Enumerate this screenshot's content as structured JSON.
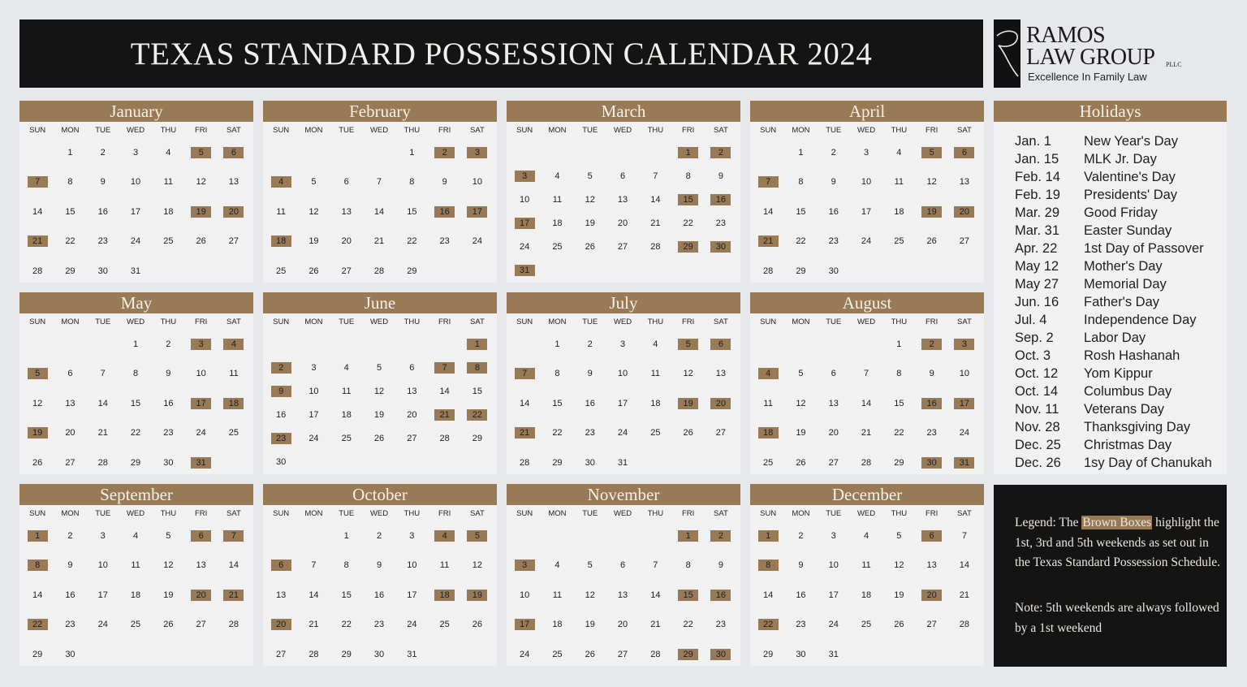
{
  "title": "TEXAS STANDARD POSSESSION CALENDAR 2024",
  "logo": {
    "line1": "RAMOS",
    "line2": "LAW GROUP",
    "suffix": "PLLC",
    "tagline": "Excellence In Family Law"
  },
  "colors": {
    "accent_brown": "#987a57",
    "title_bar": "#141414",
    "panel": "#f1f1f2",
    "background": "#e6e8eb"
  },
  "weekday_labels": [
    "SUN",
    "MON",
    "TUE",
    "WED",
    "THU",
    "FRI",
    "SAT"
  ],
  "months": [
    {
      "name": "January",
      "weeks": [
        [
          "",
          "1",
          "2",
          "3",
          "4",
          "5",
          "6"
        ],
        [
          "7",
          "8",
          "9",
          "10",
          "11",
          "12",
          "13"
        ],
        [
          "14",
          "15",
          "16",
          "17",
          "18",
          "19",
          "20"
        ],
        [
          "21",
          "22",
          "23",
          "24",
          "25",
          "26",
          "27"
        ],
        [
          "28",
          "29",
          "30",
          "31",
          "",
          "",
          ""
        ]
      ],
      "highlighted": [
        "5",
        "6",
        "7",
        "19",
        "20",
        "21"
      ]
    },
    {
      "name": "February",
      "weeks": [
        [
          "",
          "",
          "",
          "",
          "1",
          "2",
          "3"
        ],
        [
          "4",
          "5",
          "6",
          "7",
          "8",
          "9",
          "10"
        ],
        [
          "11",
          "12",
          "13",
          "14",
          "15",
          "16",
          "17"
        ],
        [
          "18",
          "19",
          "20",
          "21",
          "22",
          "23",
          "24"
        ],
        [
          "25",
          "26",
          "27",
          "28",
          "29",
          "",
          ""
        ]
      ],
      "highlighted": [
        "2",
        "3",
        "4",
        "16",
        "17",
        "18"
      ]
    },
    {
      "name": "March",
      "weeks": [
        [
          "",
          "",
          "",
          "",
          "",
          "1",
          "2"
        ],
        [
          "3",
          "4",
          "5",
          "6",
          "7",
          "8",
          "9"
        ],
        [
          "10",
          "11",
          "12",
          "13",
          "14",
          "15",
          "16"
        ],
        [
          "17",
          "18",
          "19",
          "20",
          "21",
          "22",
          "23"
        ],
        [
          "24",
          "25",
          "26",
          "27",
          "28",
          "29",
          "30"
        ],
        [
          "31",
          "",
          "",
          "",
          "",
          "",
          ""
        ]
      ],
      "highlighted": [
        "1",
        "2",
        "3",
        "15",
        "16",
        "17",
        "29",
        "30",
        "31"
      ]
    },
    {
      "name": "April",
      "weeks": [
        [
          "",
          "1",
          "2",
          "3",
          "4",
          "5",
          "6"
        ],
        [
          "7",
          "8",
          "9",
          "10",
          "11",
          "12",
          "13"
        ],
        [
          "14",
          "15",
          "16",
          "17",
          "18",
          "19",
          "20"
        ],
        [
          "21",
          "22",
          "23",
          "24",
          "25",
          "26",
          "27"
        ],
        [
          "28",
          "29",
          "30",
          "",
          "",
          "",
          ""
        ]
      ],
      "highlighted": [
        "5",
        "6",
        "7",
        "19",
        "20",
        "21"
      ]
    },
    {
      "name": "May",
      "weeks": [
        [
          "",
          "",
          "",
          "1",
          "2",
          "3",
          "4"
        ],
        [
          "5",
          "6",
          "7",
          "8",
          "9",
          "10",
          "11"
        ],
        [
          "12",
          "13",
          "14",
          "15",
          "16",
          "17",
          "18"
        ],
        [
          "19",
          "20",
          "21",
          "22",
          "23",
          "24",
          "25"
        ],
        [
          "26",
          "27",
          "28",
          "29",
          "30",
          "31",
          ""
        ]
      ],
      "highlighted": [
        "3",
        "4",
        "5",
        "17",
        "18",
        "19",
        "31"
      ]
    },
    {
      "name": "June",
      "weeks": [
        [
          "",
          "",
          "",
          "",
          "",
          "",
          "1"
        ],
        [
          "2",
          "3",
          "4",
          "5",
          "6",
          "7",
          "8"
        ],
        [
          "9",
          "10",
          "11",
          "12",
          "13",
          "14",
          "15"
        ],
        [
          "16",
          "17",
          "18",
          "19",
          "20",
          "21",
          "22"
        ],
        [
          "23",
          "24",
          "25",
          "26",
          "27",
          "28",
          "29"
        ],
        [
          "30",
          "",
          "",
          "",
          "",
          "",
          ""
        ]
      ],
      "highlighted": [
        "1",
        "2",
        "7",
        "8",
        "9",
        "21",
        "22",
        "23"
      ]
    },
    {
      "name": "July",
      "weeks": [
        [
          "",
          "1",
          "2",
          "3",
          "4",
          "5",
          "6"
        ],
        [
          "7",
          "8",
          "9",
          "10",
          "11",
          "12",
          "13"
        ],
        [
          "14",
          "15",
          "16",
          "17",
          "18",
          "19",
          "20"
        ],
        [
          "21",
          "22",
          "23",
          "24",
          "25",
          "26",
          "27"
        ],
        [
          "28",
          "29",
          "30",
          "31",
          "",
          "",
          ""
        ]
      ],
      "highlighted": [
        "5",
        "6",
        "7",
        "19",
        "20",
        "21"
      ]
    },
    {
      "name": "August",
      "weeks": [
        [
          "",
          "",
          "",
          "",
          "1",
          "2",
          "3"
        ],
        [
          "4",
          "5",
          "6",
          "7",
          "8",
          "9",
          "10"
        ],
        [
          "11",
          "12",
          "13",
          "14",
          "15",
          "16",
          "17"
        ],
        [
          "18",
          "19",
          "20",
          "21",
          "22",
          "23",
          "24"
        ],
        [
          "25",
          "26",
          "27",
          "28",
          "29",
          "30",
          "31"
        ]
      ],
      "highlighted": [
        "2",
        "3",
        "4",
        "16",
        "17",
        "18",
        "30",
        "31"
      ]
    },
    {
      "name": "September",
      "weeks": [
        [
          "1",
          "2",
          "3",
          "4",
          "5",
          "6",
          "7"
        ],
        [
          "8",
          "9",
          "10",
          "11",
          "12",
          "13",
          "14"
        ],
        [
          "14",
          "16",
          "17",
          "18",
          "19",
          "20",
          "21"
        ],
        [
          "22",
          "23",
          "24",
          "25",
          "26",
          "27",
          "28"
        ],
        [
          "29",
          "30",
          "",
          "",
          "",
          "",
          ""
        ]
      ],
      "highlighted": [
        "1",
        "6",
        "7",
        "8",
        "20",
        "21",
        "22"
      ]
    },
    {
      "name": "October",
      "weeks": [
        [
          "",
          "",
          "1",
          "2",
          "3",
          "4",
          "5"
        ],
        [
          "6",
          "7",
          "8",
          "9",
          "10",
          "11",
          "12"
        ],
        [
          "13",
          "14",
          "15",
          "16",
          "17",
          "18",
          "19"
        ],
        [
          "20",
          "21",
          "22",
          "23",
          "24",
          "25",
          "26"
        ],
        [
          "27",
          "28",
          "29",
          "30",
          "31",
          "",
          ""
        ]
      ],
      "highlighted": [
        "4",
        "5",
        "6",
        "18",
        "19",
        "20"
      ]
    },
    {
      "name": "November",
      "weeks": [
        [
          "",
          "",
          "",
          "",
          "",
          "1",
          "2"
        ],
        [
          "3",
          "4",
          "5",
          "6",
          "7",
          "8",
          "9"
        ],
        [
          "10",
          "11",
          "12",
          "13",
          "14",
          "15",
          "16"
        ],
        [
          "17",
          "18",
          "19",
          "20",
          "21",
          "22",
          "23"
        ],
        [
          "24",
          "25",
          "26",
          "27",
          "28",
          "29",
          "30"
        ]
      ],
      "highlighted": [
        "1",
        "2",
        "3",
        "15",
        "16",
        "17",
        "29",
        "30"
      ]
    },
    {
      "name": "December",
      "weeks": [
        [
          "1",
          "2",
          "3",
          "4",
          "5",
          "6",
          "7"
        ],
        [
          "8",
          "9",
          "10",
          "11",
          "12",
          "13",
          "14"
        ],
        [
          "14",
          "16",
          "17",
          "18",
          "19",
          "20",
          "21"
        ],
        [
          "22",
          "23",
          "24",
          "25",
          "26",
          "27",
          "28"
        ],
        [
          "29",
          "30",
          "31",
          "",
          "",
          "",
          ""
        ]
      ],
      "highlighted": [
        "1",
        "6",
        "8",
        "20",
        "22"
      ]
    }
  ],
  "holidays": {
    "title": "Holidays",
    "items": [
      {
        "date": "Jan. 1",
        "name": "New Year's Day"
      },
      {
        "date": "Jan. 15",
        "name": "MLK Jr. Day"
      },
      {
        "date": "Feb. 14",
        "name": "Valentine's Day"
      },
      {
        "date": "Feb. 19",
        "name": "Presidents' Day"
      },
      {
        "date": "Mar. 29",
        "name": "Good Friday"
      },
      {
        "date": "Mar. 31",
        "name": "Easter Sunday"
      },
      {
        "date": "Apr. 22",
        "name": "1st Day of Passover"
      },
      {
        "date": "May 12",
        "name": "Mother's Day"
      },
      {
        "date": "May 27",
        "name": "Memorial Day"
      },
      {
        "date": "Jun. 16",
        "name": "Father's Day"
      },
      {
        "date": "Jul. 4",
        "name": "Independence Day"
      },
      {
        "date": "Sep. 2",
        "name": "Labor Day"
      },
      {
        "date": "Oct. 3",
        "name": "Rosh Hashanah"
      },
      {
        "date": "Oct. 12",
        "name": "Yom Kippur"
      },
      {
        "date": "Oct. 14",
        "name": "Columbus Day"
      },
      {
        "date": "Nov. 11",
        "name": "Veterans Day"
      },
      {
        "date": "Nov. 28",
        "name": "Thanksgiving Day"
      },
      {
        "date": "Dec. 25",
        "name": "Christmas Day"
      },
      {
        "date": "Dec. 26",
        "name": "1sy Day of Chanukah"
      }
    ]
  },
  "legend": {
    "prefix": "Legend: The ",
    "highlight": "Brown Boxes",
    "suffix": " highlight the 1st, 3rd and 5th weekends as set out in the Texas Standard Possession Schedule.",
    "note": "Note: 5th weekends are always followed by a 1st weekend"
  }
}
